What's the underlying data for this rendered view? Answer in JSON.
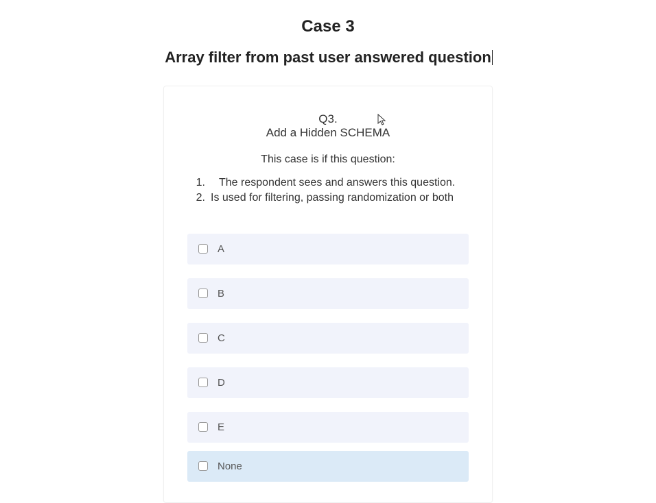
{
  "title": "Case 3",
  "subtitle": "Array filter from past user answered question",
  "question": {
    "number": "Q3.",
    "heading": "Add a Hidden SCHEMA",
    "case_intro": "This case is if this question:",
    "list": [
      {
        "num": "1.",
        "text": "The respondent sees and answers this question."
      },
      {
        "num": "2.",
        "text": "Is used for filtering, passing randomization or both"
      }
    ]
  },
  "options": [
    {
      "label": "A",
      "highlight": false
    },
    {
      "label": "B",
      "highlight": false
    },
    {
      "label": "C",
      "highlight": false
    },
    {
      "label": "D",
      "highlight": false
    },
    {
      "label": "E",
      "highlight": false
    },
    {
      "label": "None",
      "highlight": true
    }
  ]
}
